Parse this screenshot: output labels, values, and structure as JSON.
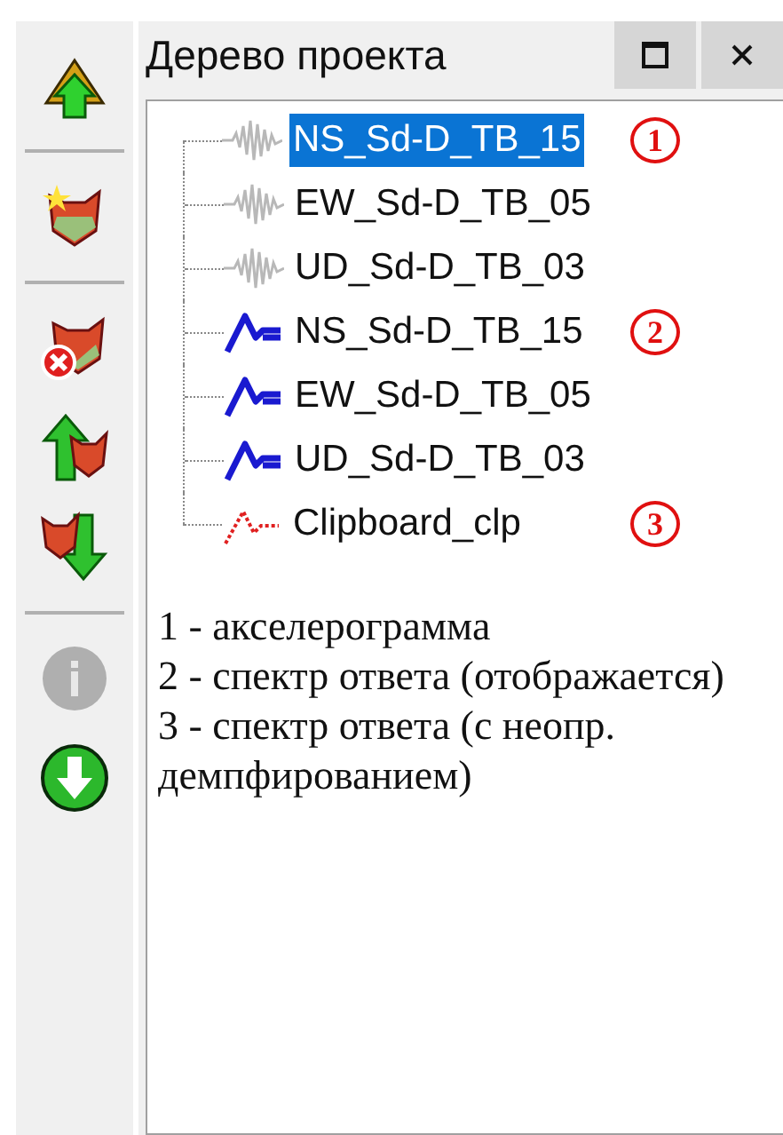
{
  "toolbar": [
    {
      "kind": "import",
      "disabled": false
    },
    {
      "kind": "separator"
    },
    {
      "kind": "new-mask",
      "disabled": false
    },
    {
      "kind": "separator"
    },
    {
      "kind": "delete-mask",
      "disabled": false
    },
    {
      "kind": "move-up",
      "disabled": false
    },
    {
      "kind": "move-down",
      "disabled": false
    },
    {
      "kind": "separator"
    },
    {
      "kind": "info",
      "disabled": true
    },
    {
      "kind": "download",
      "disabled": false
    }
  ],
  "panel": {
    "title": "Дерево проекта",
    "tree": [
      {
        "label": "NS_Sd-D_TB_15",
        "kind": "accelerogram",
        "selected": true,
        "marker": "1"
      },
      {
        "label": "EW_Sd-D_TB_05",
        "kind": "accelerogram",
        "selected": false
      },
      {
        "label": "UD_Sd-D_TB_03",
        "kind": "accelerogram",
        "selected": false
      },
      {
        "label": "NS_Sd-D_TB_15",
        "kind": "spectrum",
        "selected": false,
        "marker": "2"
      },
      {
        "label": "EW_Sd-D_TB_05",
        "kind": "spectrum",
        "selected": false
      },
      {
        "label": "UD_Sd-D_TB_03",
        "kind": "spectrum",
        "selected": false
      },
      {
        "label": "Clipboard_clp",
        "kind": "spectrum-undamped",
        "selected": false,
        "marker": "3"
      }
    ],
    "legend": [
      "1 - акселерограмма",
      "2 - спектр ответа (отображается)",
      "3 - спектр ответа (с неопр. демпфированием)"
    ]
  }
}
